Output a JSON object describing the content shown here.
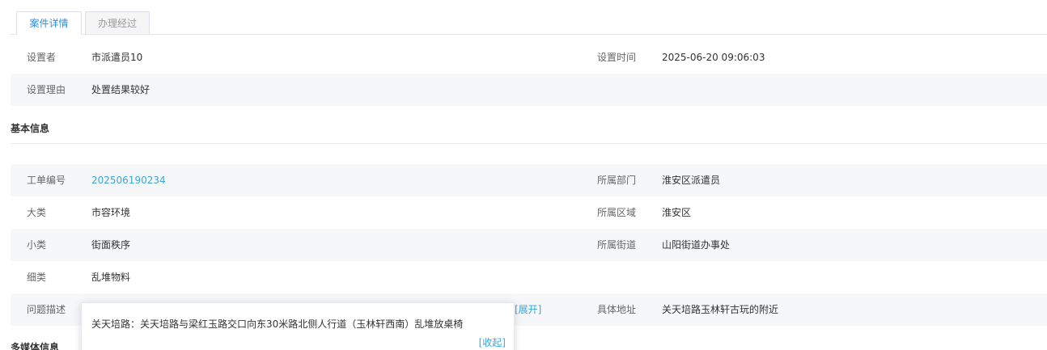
{
  "tabs": [
    {
      "label": "案件详情"
    },
    {
      "label": "办理经过"
    }
  ],
  "setting": {
    "setter_label": "设置者",
    "setter_value": "市派遣员10",
    "time_label": "设置时间",
    "time_value": "2025-06-20 09:06:03",
    "reason_label": "设置理由",
    "reason_value": "处置结果较好"
  },
  "basic_info": {
    "title": "基本信息",
    "order_label": "工单编号",
    "order_value": "202506190234",
    "dept_label": "所属部门",
    "dept_value": "淮安区派遣员",
    "category_label": "大类",
    "category_value": "市容环境",
    "region_label": "所属区域",
    "region_value": "淮安区",
    "subcategory_label": "小类",
    "subcategory_value": "街面秩序",
    "street_label": "所属街道",
    "street_value": "山阳街道办事处",
    "detail_label": "细类",
    "detail_value": "乱堆物料",
    "problem_label": "问题描述",
    "expand_label": "[展开]",
    "address_label": "具体地址",
    "address_value": "关天培路玉林轩古玩的附近"
  },
  "popover": {
    "text": "关天培路：关天培路与梁红玉路交口向东30米路北侧人行道（玉林轩西南）乱堆放桌椅",
    "collapse_label": "[收起]"
  },
  "media_info": {
    "title": "多媒体信息"
  }
}
